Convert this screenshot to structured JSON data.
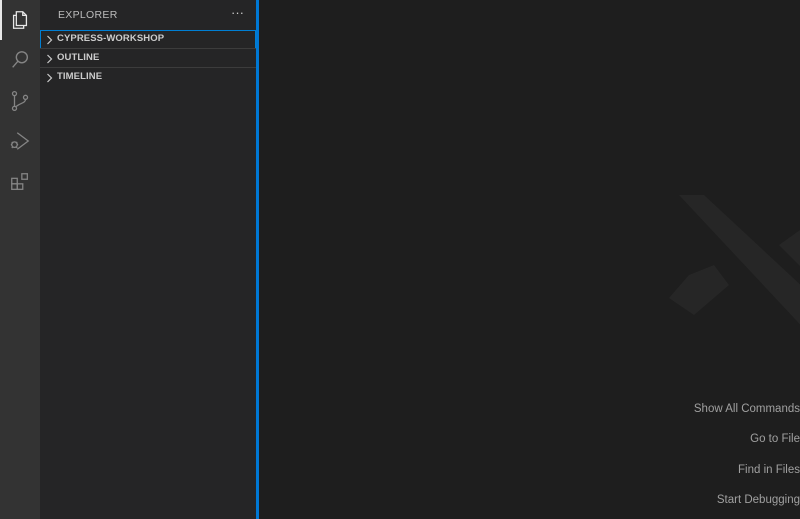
{
  "activity_bar": {
    "items": [
      {
        "icon": "files-icon",
        "active": true
      },
      {
        "icon": "search-icon",
        "active": false
      },
      {
        "icon": "source-control-icon",
        "active": false
      },
      {
        "icon": "run-debug-icon",
        "active": false
      },
      {
        "icon": "extensions-icon",
        "active": false
      }
    ]
  },
  "sidebar": {
    "title": "EXPLORER",
    "more_label": "···",
    "sections": [
      {
        "label": "CYPRESS-WORKSHOP",
        "focused": true
      },
      {
        "label": "OUTLINE",
        "focused": false
      },
      {
        "label": "TIMELINE",
        "focused": false
      }
    ]
  },
  "editor": {
    "watermark_icon": "vscode-logo-icon",
    "hints": [
      {
        "label": "Show All Commands"
      },
      {
        "label": "Go to File"
      },
      {
        "label": "Find in Files"
      },
      {
        "label": "Start Debugging"
      }
    ]
  },
  "colors": {
    "accent": "#0078d4",
    "focus_border": "#007fd4",
    "activity_bar": "#333333",
    "sidebar": "#252526",
    "editor": "#1e1e1e"
  }
}
